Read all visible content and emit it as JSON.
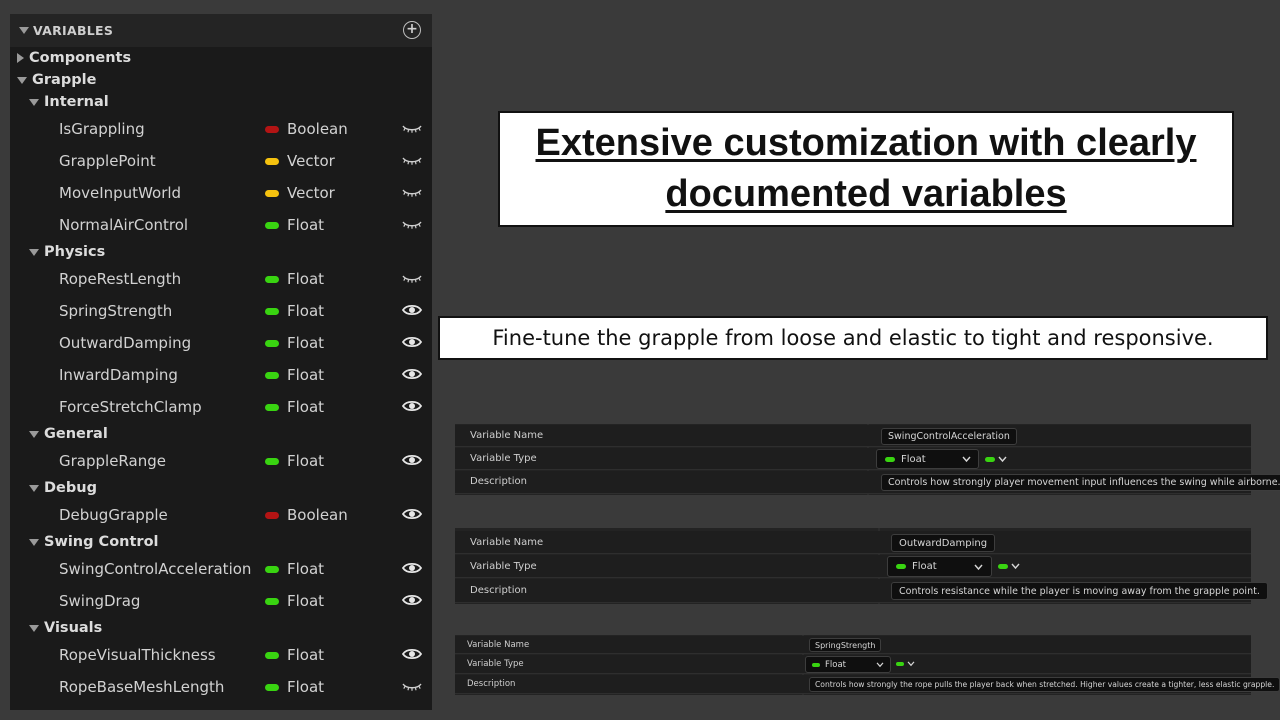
{
  "panel": {
    "title": "VARIABLES",
    "add_icon": "plus-circle-icon",
    "rows": [
      {
        "kind": "cat",
        "indent": 0,
        "expanded": false,
        "label": "Components"
      },
      {
        "kind": "cat",
        "indent": 0,
        "expanded": true,
        "label": "Grapple"
      },
      {
        "kind": "cat",
        "indent": 1,
        "expanded": true,
        "label": "Internal"
      },
      {
        "kind": "var",
        "name": "IsGrappling",
        "type": "Boolean",
        "color": "#b31414",
        "visible": false
      },
      {
        "kind": "var",
        "name": "GrapplePoint",
        "type": "Vector",
        "color": "#f5c20f",
        "visible": false
      },
      {
        "kind": "var",
        "name": "MoveInputWorld",
        "type": "Vector",
        "color": "#f5c20f",
        "visible": false
      },
      {
        "kind": "var",
        "name": "NormalAirControl",
        "type": "Float",
        "color": "#39d411",
        "visible": false
      },
      {
        "kind": "cat",
        "indent": 1,
        "expanded": true,
        "label": "Physics"
      },
      {
        "kind": "var",
        "name": "RopeRestLength",
        "type": "Float",
        "color": "#39d411",
        "visible": false
      },
      {
        "kind": "var",
        "name": "SpringStrength",
        "type": "Float",
        "color": "#39d411",
        "visible": true
      },
      {
        "kind": "var",
        "name": "OutwardDamping",
        "type": "Float",
        "color": "#39d411",
        "visible": true
      },
      {
        "kind": "var",
        "name": "InwardDamping",
        "type": "Float",
        "color": "#39d411",
        "visible": true
      },
      {
        "kind": "var",
        "name": "ForceStretchClamp",
        "type": "Float",
        "color": "#39d411",
        "visible": true
      },
      {
        "kind": "cat",
        "indent": 1,
        "expanded": true,
        "label": "General"
      },
      {
        "kind": "var",
        "name": "GrappleRange",
        "type": "Float",
        "color": "#39d411",
        "visible": true
      },
      {
        "kind": "cat",
        "indent": 1,
        "expanded": true,
        "label": "Debug"
      },
      {
        "kind": "var",
        "name": "DebugGrapple",
        "type": "Boolean",
        "color": "#b31414",
        "visible": true
      },
      {
        "kind": "cat",
        "indent": 1,
        "expanded": true,
        "label": "Swing Control"
      },
      {
        "kind": "var",
        "name": "SwingControlAcceleration",
        "type": "Float",
        "color": "#39d411",
        "visible": true
      },
      {
        "kind": "var",
        "name": "SwingDrag",
        "type": "Float",
        "color": "#39d411",
        "visible": true
      },
      {
        "kind": "cat",
        "indent": 1,
        "expanded": true,
        "label": "Visuals"
      },
      {
        "kind": "var",
        "name": "RopeVisualThickness",
        "type": "Float",
        "color": "#39d411",
        "visible": true
      },
      {
        "kind": "var",
        "name": "RopeBaseMeshLength",
        "type": "Float",
        "color": "#39d411",
        "visible": false
      }
    ]
  },
  "headline": {
    "line1": "Extensive customization with clearly",
    "line2": "documented variables"
  },
  "subtitle": "Fine-tune the grapple from loose and elastic to tight and responsive.",
  "cards": [
    {
      "labels": {
        "name": "Variable Name",
        "type": "Variable Type",
        "desc": "Description"
      },
      "name_value": "SwingControlAcceleration",
      "type_value": "Float",
      "description": "Controls how strongly player movement input influences the swing while airborne."
    },
    {
      "labels": {
        "name": "Variable Name",
        "type": "Variable Type",
        "desc": "Description"
      },
      "name_value": "OutwardDamping",
      "type_value": "Float",
      "description": "Controls resistance while the player is moving away from the grapple point."
    },
    {
      "labels": {
        "name": "Variable Name",
        "type": "Variable Type",
        "desc": "Description"
      },
      "name_value": "SpringStrength",
      "type_value": "Float",
      "description": "Controls how strongly the rope pulls the player back when stretched. Higher values create a tighter, less elastic grapple."
    }
  ]
}
